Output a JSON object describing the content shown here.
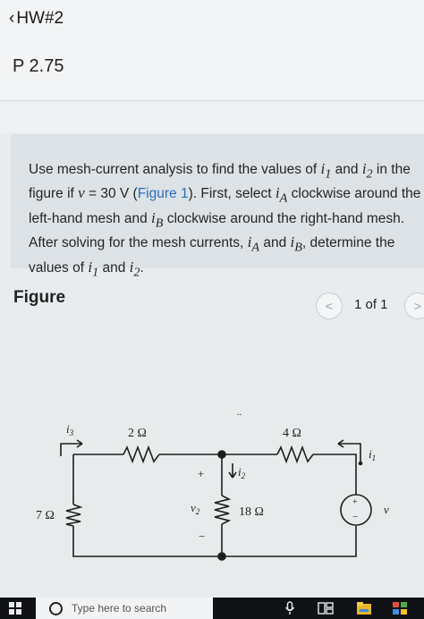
{
  "header": {
    "back_label": "HW#2",
    "problem_id": "P 2.75"
  },
  "question": {
    "p1": "Use mesh-current analysis to find the values of ",
    "i1": "i",
    "i1_sub": "1",
    "p2": " and ",
    "i2": "i",
    "i2_sub": "2",
    "p3": " in the figure if ",
    "v": "v",
    "p4": " = 30 V (",
    "figure_link": "Figure 1",
    "p5": "). First, select ",
    "iA": "i",
    "iA_sub": "A",
    "p6": " clockwise around the left-hand mesh and ",
    "iB": "i",
    "iB_sub": "B",
    "p7": " clockwise around the right-hand mesh. After solving for the mesh currents, ",
    "p8": " and ",
    "p9": ", determine the values of ",
    "p10": " and ",
    "p11": "."
  },
  "figure": {
    "title": "Figure",
    "pager": "1 of 1",
    "prev_glyph": "<",
    "next_glyph": ">"
  },
  "circuit": {
    "r_top_left": "2 Ω",
    "r_top_right": "4 Ω",
    "r_left": "7 Ω",
    "r_mid": "18 Ω",
    "i3_label": "i",
    "i3_sub": "3",
    "i2_label": "i",
    "i2_sub": "2",
    "i1_label": "i",
    "i1_sub": "1",
    "v2_label": "v",
    "v2_sub": "2",
    "source_label": "v",
    "plus": "+",
    "minus": "−",
    "dots": ".."
  },
  "taskbar": {
    "search_placeholder": "Type here to search"
  }
}
